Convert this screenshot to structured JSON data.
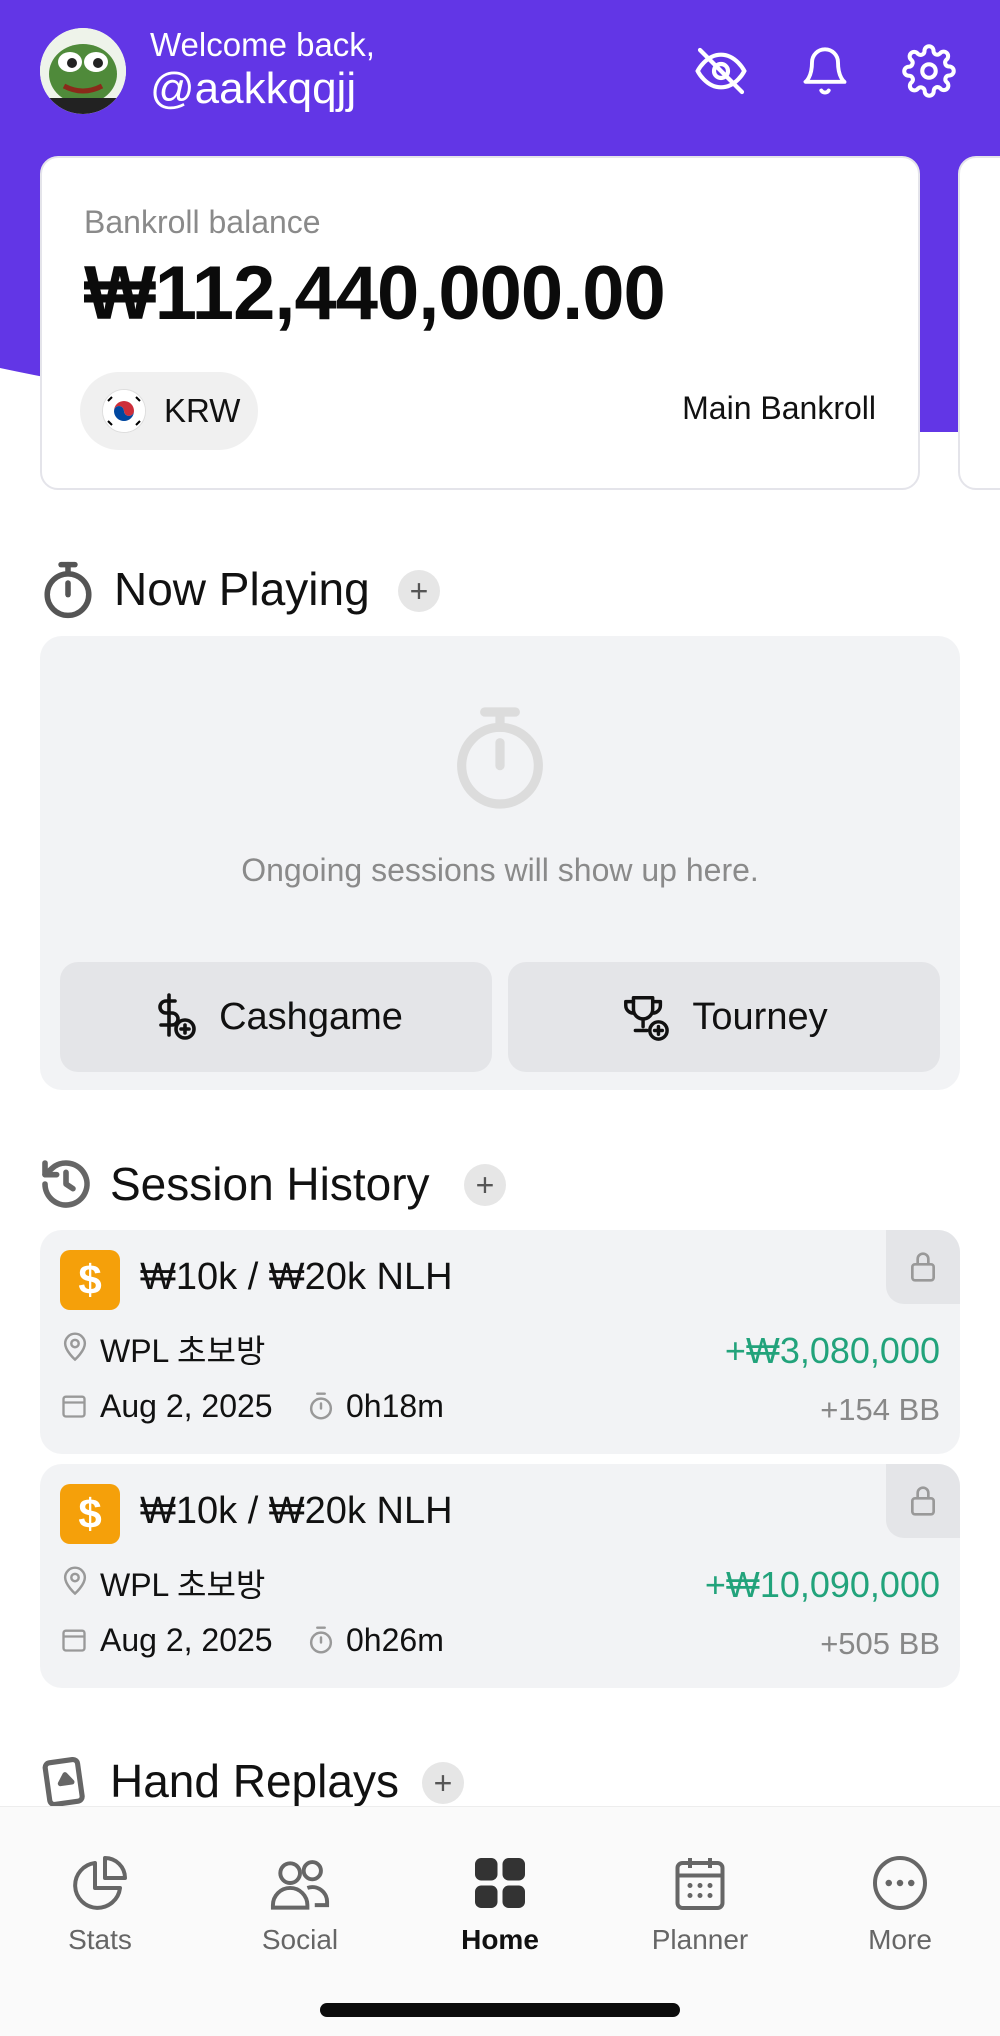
{
  "header": {
    "welcome": "Welcome back,",
    "username": "@aakkqqjj",
    "icons": [
      "eye-off-icon",
      "bell-icon",
      "gear-icon"
    ],
    "accent": "#6236e6"
  },
  "bankroll": {
    "label": "Bankroll balance",
    "balance": "₩112,440,000.00",
    "currency": "KRW",
    "name": "Main Bankroll"
  },
  "now_playing": {
    "title": "Now Playing",
    "empty_message": "Ongoing sessions will show up here.",
    "cashgame_label": "Cashgame",
    "tourney_label": "Tourney"
  },
  "session_history": {
    "title": "Session History",
    "sessions": [
      {
        "title": "₩10k / ₩20k NLH",
        "location": "WPL 초보방",
        "date": "Aug 2, 2025",
        "duration": "0h18m",
        "profit": "+₩3,080,000",
        "bb": "+154 BB"
      },
      {
        "title": "₩10k / ₩20k NLH",
        "location": "WPL 초보방",
        "date": "Aug 2, 2025",
        "duration": "0h26m",
        "profit": "+₩10,090,000",
        "bb": "+505 BB"
      }
    ],
    "profit_color": "#22a37b",
    "badge_color": "#f5a00a"
  },
  "hand_replays": {
    "title": "Hand Replays"
  },
  "tabbar": {
    "tabs": [
      {
        "label": "Stats",
        "icon": "pie-chart-icon"
      },
      {
        "label": "Social",
        "icon": "users-icon"
      },
      {
        "label": "Home",
        "icon": "grid-icon",
        "active": true
      },
      {
        "label": "Planner",
        "icon": "calendar-icon"
      },
      {
        "label": "More",
        "icon": "more-icon"
      }
    ]
  }
}
